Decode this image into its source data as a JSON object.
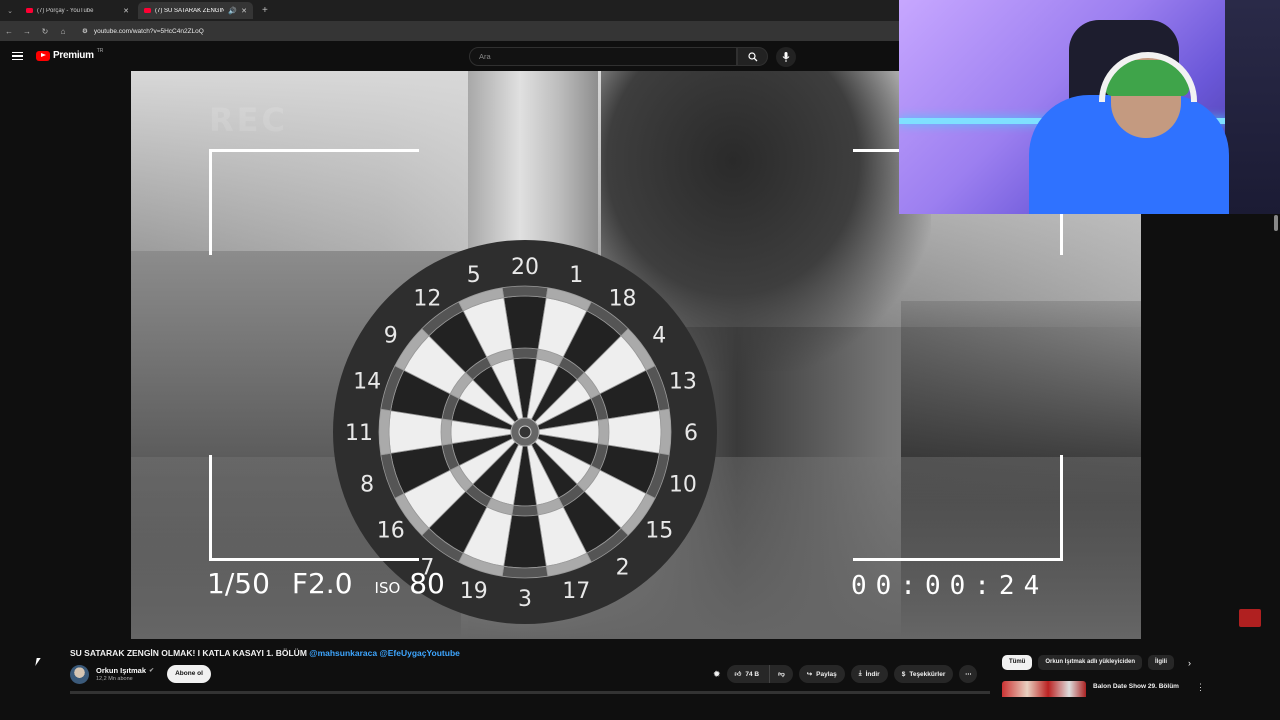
{
  "browser": {
    "tabs": [
      {
        "title": "(7) Porçay - YouTube",
        "active": false
      },
      {
        "title": "(7) SU SATARAK ZENGİN OL",
        "active": true
      }
    ],
    "url": "youtube.com/watch?v=5HcC4n2ZLoQ"
  },
  "youtube": {
    "logo_text": "Premium",
    "logo_region": "TR",
    "search_placeholder": "Ara"
  },
  "video_overlay": {
    "rec_text": "REC",
    "shutter": "1/50",
    "aperture": "F2.0",
    "iso_label": "ISO",
    "iso_value": "80",
    "timecode": "00:00:24"
  },
  "dartboard": {
    "numbers": [
      "20",
      "1",
      "18",
      "4",
      "13",
      "6",
      "10",
      "15",
      "2",
      "17",
      "3",
      "19",
      "7",
      "16",
      "8",
      "11",
      "14",
      "9",
      "12",
      "5"
    ]
  },
  "video": {
    "title": "SU SATARAK ZENGİN OLMAK! I KATLA KASAYI 1. BÖLÜM",
    "title_tags": "@mahsunkaraca @EfeUygaçYoutube",
    "channel_name": "Orkun Işıtmak",
    "subscribers": "12,2 Mn abone",
    "subscribe_label": "Abone ol",
    "likes": "74 B",
    "share_label": "Paylaş",
    "download_label": "İndir",
    "thanks_label": "Teşekkürler"
  },
  "chips": [
    {
      "label": "Tümü",
      "active": true
    },
    {
      "label": "Orkun Işıtmak adlı yükleyiciden",
      "active": false
    },
    {
      "label": "İlgili",
      "active": false
    }
  ],
  "recommendation": {
    "title": "Balon Date Show 29. Bölüm"
  },
  "colors": {
    "background": "#0f0f0f",
    "accent_red": "#ff0000",
    "link_blue": "#3ea6ff"
  }
}
